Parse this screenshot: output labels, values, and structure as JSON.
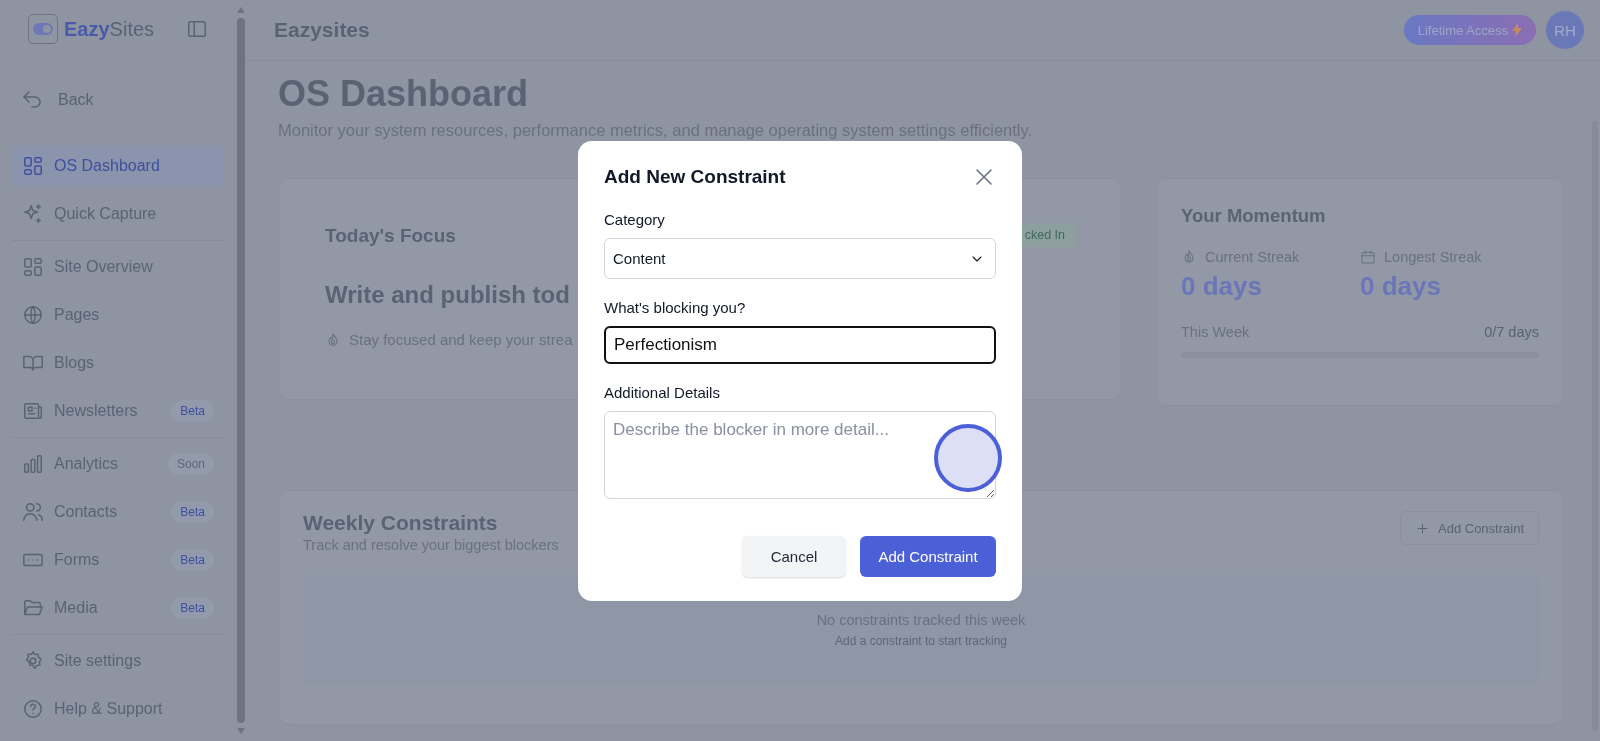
{
  "sidebar": {
    "logo": {
      "bold": "Eazy",
      "rest": "Sites"
    },
    "back": "Back",
    "groups": [
      [
        {
          "label": "OS Dashboard",
          "selected": true
        },
        {
          "label": "Quick Capture",
          "selected": false
        }
      ],
      [
        {
          "label": "Site Overview",
          "selected": false
        },
        {
          "label": "Pages",
          "selected": false
        },
        {
          "label": "Blogs",
          "selected": false
        },
        {
          "label": "Newsletters",
          "selected": false,
          "badge": {
            "text": "Beta",
            "kind": "beta"
          }
        }
      ],
      [
        {
          "label": "Analytics",
          "selected": false,
          "badge": {
            "text": "Soon",
            "kind": "soon"
          }
        },
        {
          "label": "Contacts",
          "selected": false,
          "badge": {
            "text": "Beta",
            "kind": "beta"
          }
        },
        {
          "label": "Forms",
          "selected": false,
          "badge": {
            "text": "Beta",
            "kind": "beta"
          }
        },
        {
          "label": "Media",
          "selected": false,
          "badge": {
            "text": "Beta",
            "kind": "beta"
          }
        }
      ],
      [
        {
          "label": "Site settings",
          "selected": false
        },
        {
          "label": "Help & Support",
          "selected": false
        }
      ]
    ]
  },
  "header": {
    "title": "Eazysites",
    "lifetime_button": "Lifetime Access",
    "avatar": "RH"
  },
  "page": {
    "title": "OS Dashboard",
    "subtitle": "Monitor your system resources, performance metrics, and manage operating system settings efficiently."
  },
  "focus_card": {
    "title": "Today's Focus",
    "status_badge": "cked In",
    "goal": "Write and publish tod",
    "hint": "Stay focused and keep your strea"
  },
  "momentum_card": {
    "title": "Your Momentum",
    "stats": [
      {
        "label": "Current Streak",
        "value": "0 days"
      },
      {
        "label": "Longest Streak",
        "value": "0 days"
      }
    ],
    "this_week": {
      "label": "This Week",
      "reading": "0/7 days",
      "level": 0
    }
  },
  "constraints": {
    "title": "Weekly Constraints",
    "subtitle": "Track and resolve your biggest blockers",
    "add_button": "Add Constraint",
    "empty_title": "No constraints tracked this week",
    "empty_hint": "Add a constraint to start tracking"
  },
  "dialog": {
    "title": "Add New Constraint",
    "fields": [
      {
        "label": "Category",
        "kind": "select",
        "value": "Content"
      },
      {
        "label": "What's blocking you?",
        "kind": "input",
        "value": "Perfectionism",
        "focused": true
      },
      {
        "label": "Additional Details",
        "kind": "textarea",
        "placeholder": "Describe the blocker in more detail..."
      }
    ],
    "buttons": [
      {
        "label": "Cancel",
        "kind": "secondary"
      },
      {
        "label": "Add Constraint",
        "kind": "primary"
      }
    ]
  }
}
